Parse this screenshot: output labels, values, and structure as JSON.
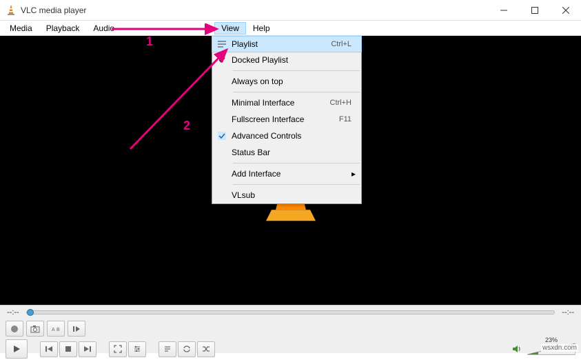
{
  "titlebar": {
    "title": "VLC media player"
  },
  "menubar": {
    "items": [
      "Media",
      "Playback",
      "Audio"
    ],
    "hidden_gap_label": "",
    "view_label": "View",
    "help_label": "Help"
  },
  "dropdown": {
    "playlist": {
      "label": "Playlist",
      "shortcut": "Ctrl+L"
    },
    "docked_playlist": {
      "label": "Docked Playlist"
    },
    "always_on_top": {
      "label": "Always on top"
    },
    "minimal_interface": {
      "label": "Minimal Interface",
      "shortcut": "Ctrl+H"
    },
    "fullscreen_interface": {
      "label": "Fullscreen Interface",
      "shortcut": "F11"
    },
    "advanced_controls": {
      "label": "Advanced Controls"
    },
    "status_bar": {
      "label": "Status Bar"
    },
    "add_interface": {
      "label": "Add Interface"
    },
    "vlsub": {
      "label": "VLsub"
    }
  },
  "time": {
    "elapsed": "--:--",
    "total": "--:--"
  },
  "volume": {
    "percent": "23%"
  },
  "annotations": {
    "one": "1",
    "two": "2"
  },
  "watermark": "wsxdn.com"
}
